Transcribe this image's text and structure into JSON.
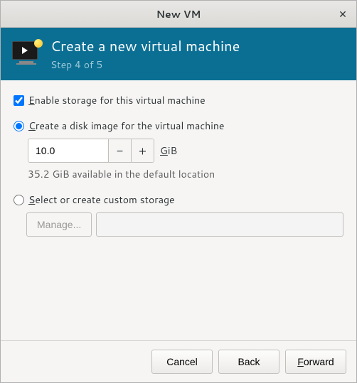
{
  "window": {
    "title": "New VM"
  },
  "header": {
    "title": "Create a new virtual machine",
    "step": "Step 4 of 5"
  },
  "storage": {
    "enable_label_pre": "",
    "enable_mnemonic": "E",
    "enable_label_post": "nable storage for this virtual machine",
    "create_mnemonic": "C",
    "create_label_post": "reate a disk image for the virtual machine",
    "size_value": "10.0",
    "unit_mnemonic": "G",
    "unit_post": "iB",
    "available_hint": "35.2 GiB available in the default location",
    "select_mnemonic": "S",
    "select_label_post": "elect or create custom storage",
    "manage_label": "Manage...",
    "path_value": ""
  },
  "buttons": {
    "cancel": "Cancel",
    "back": "Back",
    "forward_mnemonic": "F",
    "forward_post": "orward"
  }
}
